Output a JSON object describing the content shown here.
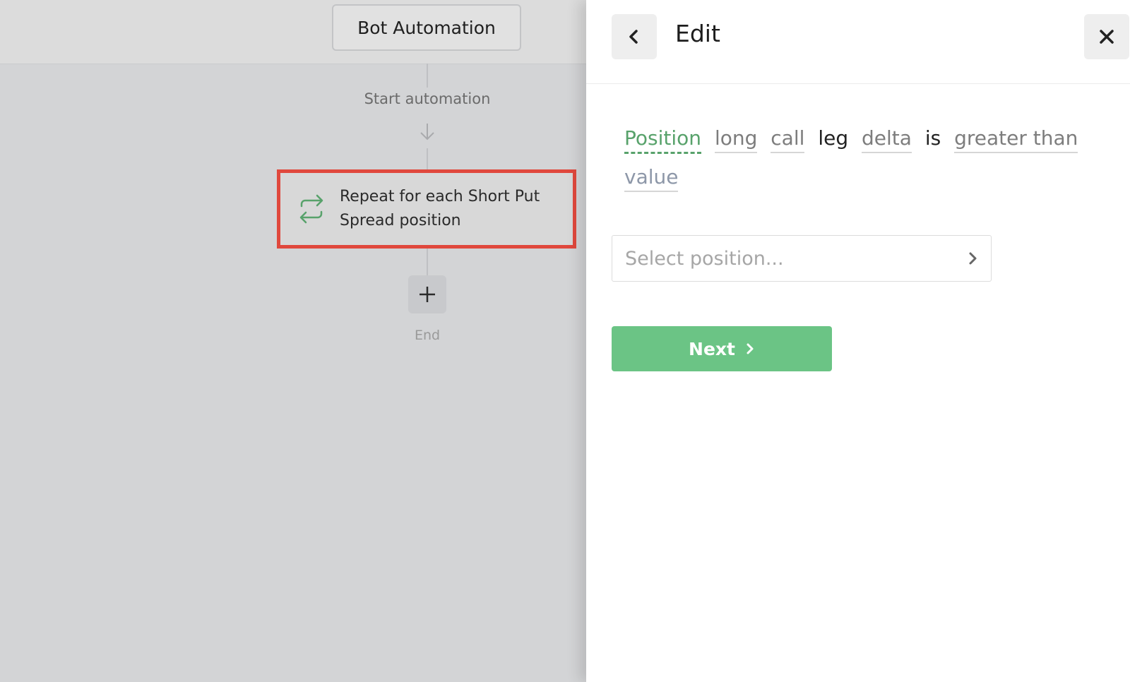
{
  "canvas": {
    "bot_title": "Bot Automation",
    "start_label": "Start automation",
    "loop_node": {
      "label": "Repeat for each Short Put Spread position",
      "icon": "repeat-icon",
      "highlight_color": "#e0483d",
      "icon_color": "#58a26b"
    },
    "add_step_icon": "plus-icon",
    "end_label": "End"
  },
  "panel": {
    "title": "Edit",
    "back_icon": "chevron-left-icon",
    "close_icon": "close-icon",
    "sentence_tokens": [
      {
        "text": "Position",
        "kind": "active"
      },
      {
        "text": "long",
        "kind": "option"
      },
      {
        "text": "call",
        "kind": "option"
      },
      {
        "text": "leg",
        "kind": "plain"
      },
      {
        "text": "delta",
        "kind": "option"
      },
      {
        "text": "is",
        "kind": "plain"
      },
      {
        "text": "greater than",
        "kind": "option"
      },
      {
        "text": "value",
        "kind": "value"
      }
    ],
    "select": {
      "placeholder": "Select position...",
      "icon": "chevron-right-icon"
    },
    "next_button": {
      "label": "Next",
      "icon": "chevron-right-icon",
      "color": "#6bc485"
    },
    "accent_color": "#58a26b"
  }
}
